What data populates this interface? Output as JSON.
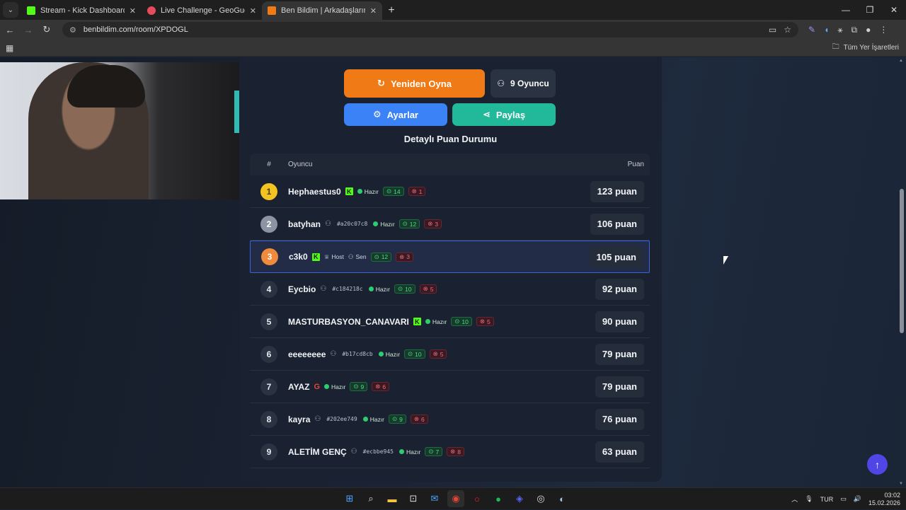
{
  "browser": {
    "tabs": [
      {
        "title": "Stream - Kick Dashboard",
        "fav_color": "#53fc18",
        "active": false
      },
      {
        "title": "Live Challenge - GeoGuessr",
        "fav_color": "#e74c5c",
        "active": false
      },
      {
        "title": "Ben Bildim | Arkadaşlarınla Onli",
        "fav_color": "#f07a16",
        "active": true
      }
    ],
    "url": "benbildim.com/room/XPDOGL",
    "bookmarks_label": "Tüm Yer İşaretleri"
  },
  "room": {
    "replay_label": "Yeniden Oyna",
    "players_count_label": "9 Oyuncu",
    "settings_label": "Ayarlar",
    "share_label": "Paylaş",
    "section_title": "Detaylı Puan Durumu",
    "columns": {
      "rank": "#",
      "player": "Oyuncu",
      "score": "Puan"
    },
    "rows": [
      {
        "rank": "1",
        "name": "Hephaestus0",
        "kick": true,
        "google": false,
        "guest": false,
        "hash": "",
        "host": false,
        "me": false,
        "status": "Hazır",
        "correct": "14",
        "wrong": "1",
        "score": "123 puan"
      },
      {
        "rank": "2",
        "name": "batyhan",
        "kick": false,
        "google": false,
        "guest": true,
        "hash": "#a20c07c8",
        "host": false,
        "me": false,
        "status": "Hazır",
        "correct": "12",
        "wrong": "3",
        "score": "106 puan"
      },
      {
        "rank": "3",
        "name": "c3k0",
        "kick": true,
        "google": false,
        "guest": false,
        "hash": "",
        "host": true,
        "host_label": "Host",
        "me": true,
        "me_label": "Sen",
        "status": "",
        "correct": "12",
        "wrong": "3",
        "score": "105 puan"
      },
      {
        "rank": "4",
        "name": "Eycbio",
        "kick": false,
        "google": false,
        "guest": true,
        "hash": "#c184218c",
        "host": false,
        "me": false,
        "status": "Hazır",
        "correct": "10",
        "wrong": "5",
        "score": "92 puan"
      },
      {
        "rank": "5",
        "name": "MASTURBASYON_CANAVARI",
        "kick": true,
        "google": false,
        "guest": false,
        "hash": "",
        "host": false,
        "me": false,
        "status": "Hazır",
        "correct": "10",
        "wrong": "5",
        "score": "90 puan"
      },
      {
        "rank": "6",
        "name": "eeeeeeee",
        "kick": false,
        "google": false,
        "guest": true,
        "hash": "#b17cd8cb",
        "host": false,
        "me": false,
        "status": "Hazır",
        "correct": "10",
        "wrong": "5",
        "score": "79 puan"
      },
      {
        "rank": "7",
        "name": "AYAZ",
        "kick": false,
        "google": true,
        "guest": false,
        "hash": "",
        "host": false,
        "me": false,
        "status": "Hazır",
        "correct": "9",
        "wrong": "6",
        "score": "79 puan"
      },
      {
        "rank": "8",
        "name": "kayra",
        "kick": false,
        "google": false,
        "guest": true,
        "hash": "#202ee749",
        "host": false,
        "me": false,
        "status": "Hazır",
        "correct": "9",
        "wrong": "6",
        "score": "76 puan"
      },
      {
        "rank": "9",
        "name": "ALETİM GENÇ",
        "kick": false,
        "google": false,
        "guest": true,
        "hash": "#ecbbe945",
        "host": false,
        "me": false,
        "status": "Hazır",
        "correct": "7",
        "wrong": "8",
        "score": "63 puan"
      }
    ]
  },
  "taskbar": {
    "lang": "TUR",
    "time": "03:02",
    "date": "15.02.2026"
  }
}
